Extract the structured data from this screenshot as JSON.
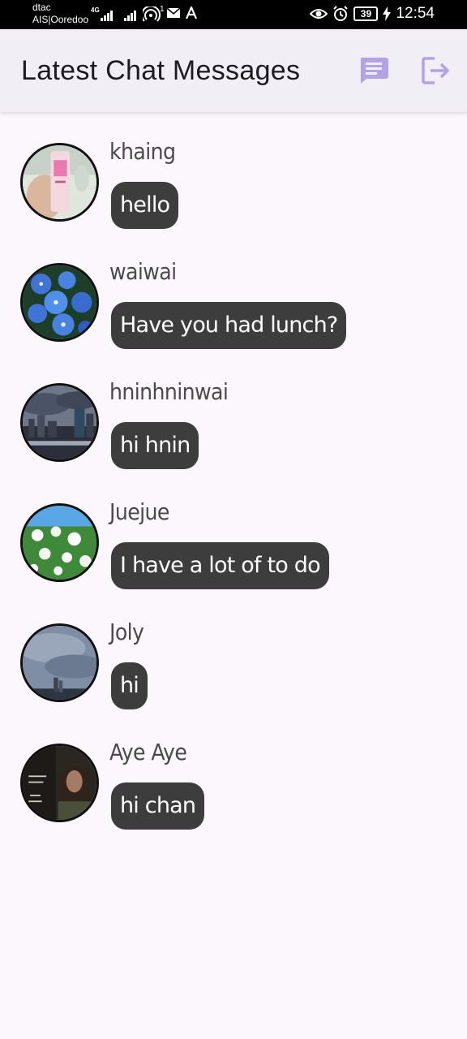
{
  "status_bar": {
    "carrier_top": "dtac",
    "carrier_bottom": "AIS|Ooredoo",
    "network": "4G",
    "hotspot_badge": "1",
    "battery": "39",
    "time": "12:54"
  },
  "app_bar": {
    "title": "Latest Chat Messages",
    "icons": [
      "chat-icon",
      "logout-icon"
    ],
    "icon_color": "#b3a2e8"
  },
  "chats": [
    {
      "name": "khaing",
      "message": "hello"
    },
    {
      "name": "waiwai",
      "message": "Have you had lunch?"
    },
    {
      "name": "hninhninwai",
      "message": "hi hnin"
    },
    {
      "name": "Juejue",
      "message": "I have a lot of to do"
    },
    {
      "name": "Joly",
      "message": "hi"
    },
    {
      "name": "Aye Aye",
      "message": "hi chan"
    }
  ],
  "colors": {
    "background": "#fcf7fc",
    "app_bar": "#f2eef5",
    "bubble": "#3d3d3d",
    "bubble_text": "#ffffff"
  }
}
